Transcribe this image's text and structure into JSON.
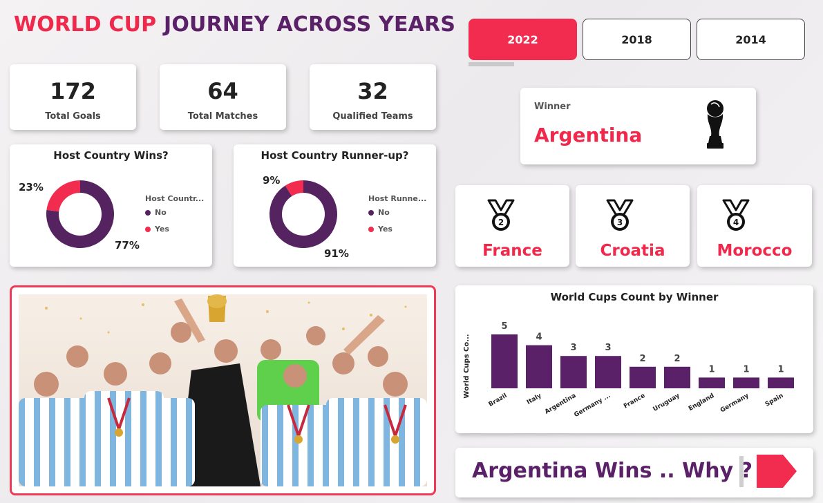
{
  "title": {
    "part1": "WORLD CUP",
    "part2": "JOURNEY ACROSS YEARS"
  },
  "year_buttons": [
    {
      "label": "2022",
      "active": true
    },
    {
      "label": "2018",
      "active": false
    },
    {
      "label": "2014",
      "active": false
    }
  ],
  "kpis": [
    {
      "value": "172",
      "label": "Total Goals"
    },
    {
      "value": "64",
      "label": "Total Matches"
    },
    {
      "value": "32",
      "label": "Qualified Teams"
    }
  ],
  "host_wins": {
    "title": "Host Country Wins?",
    "legend_title": "Host Countr...",
    "legend": [
      "No",
      "Yes"
    ],
    "yes_label": "23%",
    "no_label": "77%",
    "yes_pct": 23,
    "no_pct": 77
  },
  "host_runnerup": {
    "title": "Host Country Runner-up?",
    "legend_title": "Host Runne...",
    "legend": [
      "No",
      "Yes"
    ],
    "yes_label": "9%",
    "no_label": "91%",
    "yes_pct": 9,
    "no_pct": 91
  },
  "winner": {
    "label": "Winner",
    "name": "Argentina",
    "icon": "trophy-icon"
  },
  "places": [
    {
      "rank": "2",
      "name": "France",
      "icon": "medal-icon"
    },
    {
      "rank": "3",
      "name": "Croatia",
      "icon": "medal-icon"
    },
    {
      "rank": "4",
      "name": "Morocco",
      "icon": "medal-icon"
    }
  ],
  "cta": {
    "text": "Argentina Wins .. Why ?",
    "icon": "arrow-right-icon"
  },
  "colors": {
    "accent": "#f22c4f",
    "purple": "#5b2168",
    "no": "#55235f",
    "yes": "#f22c4f"
  },
  "chart_data": {
    "type": "bar",
    "title": "World Cups Count by Winner",
    "ylabel": "World Cups Co...",
    "xlabel": "",
    "categories": [
      "Brazil",
      "Italy",
      "Argentina",
      "Germany ...",
      "France",
      "Uruguay",
      "England",
      "Germany",
      "Spain"
    ],
    "values": [
      5,
      4,
      3,
      3,
      2,
      2,
      1,
      1,
      1
    ],
    "ylim": [
      0,
      5
    ],
    "grid": false
  }
}
